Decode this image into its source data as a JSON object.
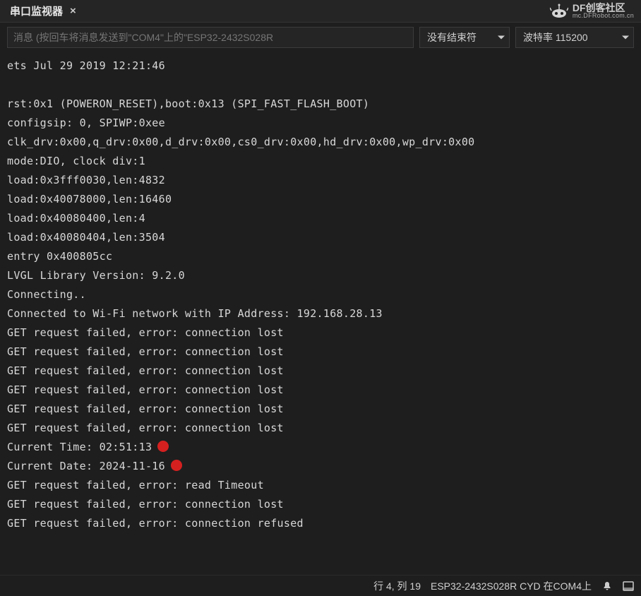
{
  "tab": {
    "title": "串口监视器",
    "close_glyph": "×"
  },
  "watermark": {
    "brand": "DF创客社区",
    "url": "mc.DFRobot.com.cn"
  },
  "toolbar": {
    "message_placeholder": "消息 (按回车将消息发送到\"COM4\"上的\"ESP32-2432S028R",
    "line_ending": "没有结束符",
    "baud_label": "波特率 115200"
  },
  "console_lines": [
    "ets Jul 29 2019 12:21:46",
    "",
    "rst:0x1 (POWERON_RESET),boot:0x13 (SPI_FAST_FLASH_BOOT)",
    "configsip: 0, SPIWP:0xee",
    "clk_drv:0x00,q_drv:0x00,d_drv:0x00,cs0_drv:0x00,hd_drv:0x00,wp_drv:0x00",
    "mode:DIO, clock div:1",
    "load:0x3fff0030,len:4832",
    "load:0x40078000,len:16460",
    "load:0x40080400,len:4",
    "load:0x40080404,len:3504",
    "entry 0x400805cc",
    "LVGL Library Version: 9.2.0",
    "Connecting..",
    "Connected to Wi-Fi network with IP Address: 192.168.28.13",
    "GET request failed, error: connection lost",
    "GET request failed, error: connection lost",
    "GET request failed, error: connection lost",
    "GET request failed, error: connection lost",
    "GET request failed, error: connection lost",
    "GET request failed, error: connection lost",
    "Current Time: 02:51:13",
    "Current Date: 2024-11-16",
    "GET request failed, error: read Timeout",
    "GET request failed, error: connection lost",
    "GET request failed, error: connection refused"
  ],
  "annotated_lines": [
    20,
    21
  ],
  "status": {
    "cursor": "行 4, 列 19",
    "board": "ESP32-2432S028R CYD 在COM4上"
  }
}
